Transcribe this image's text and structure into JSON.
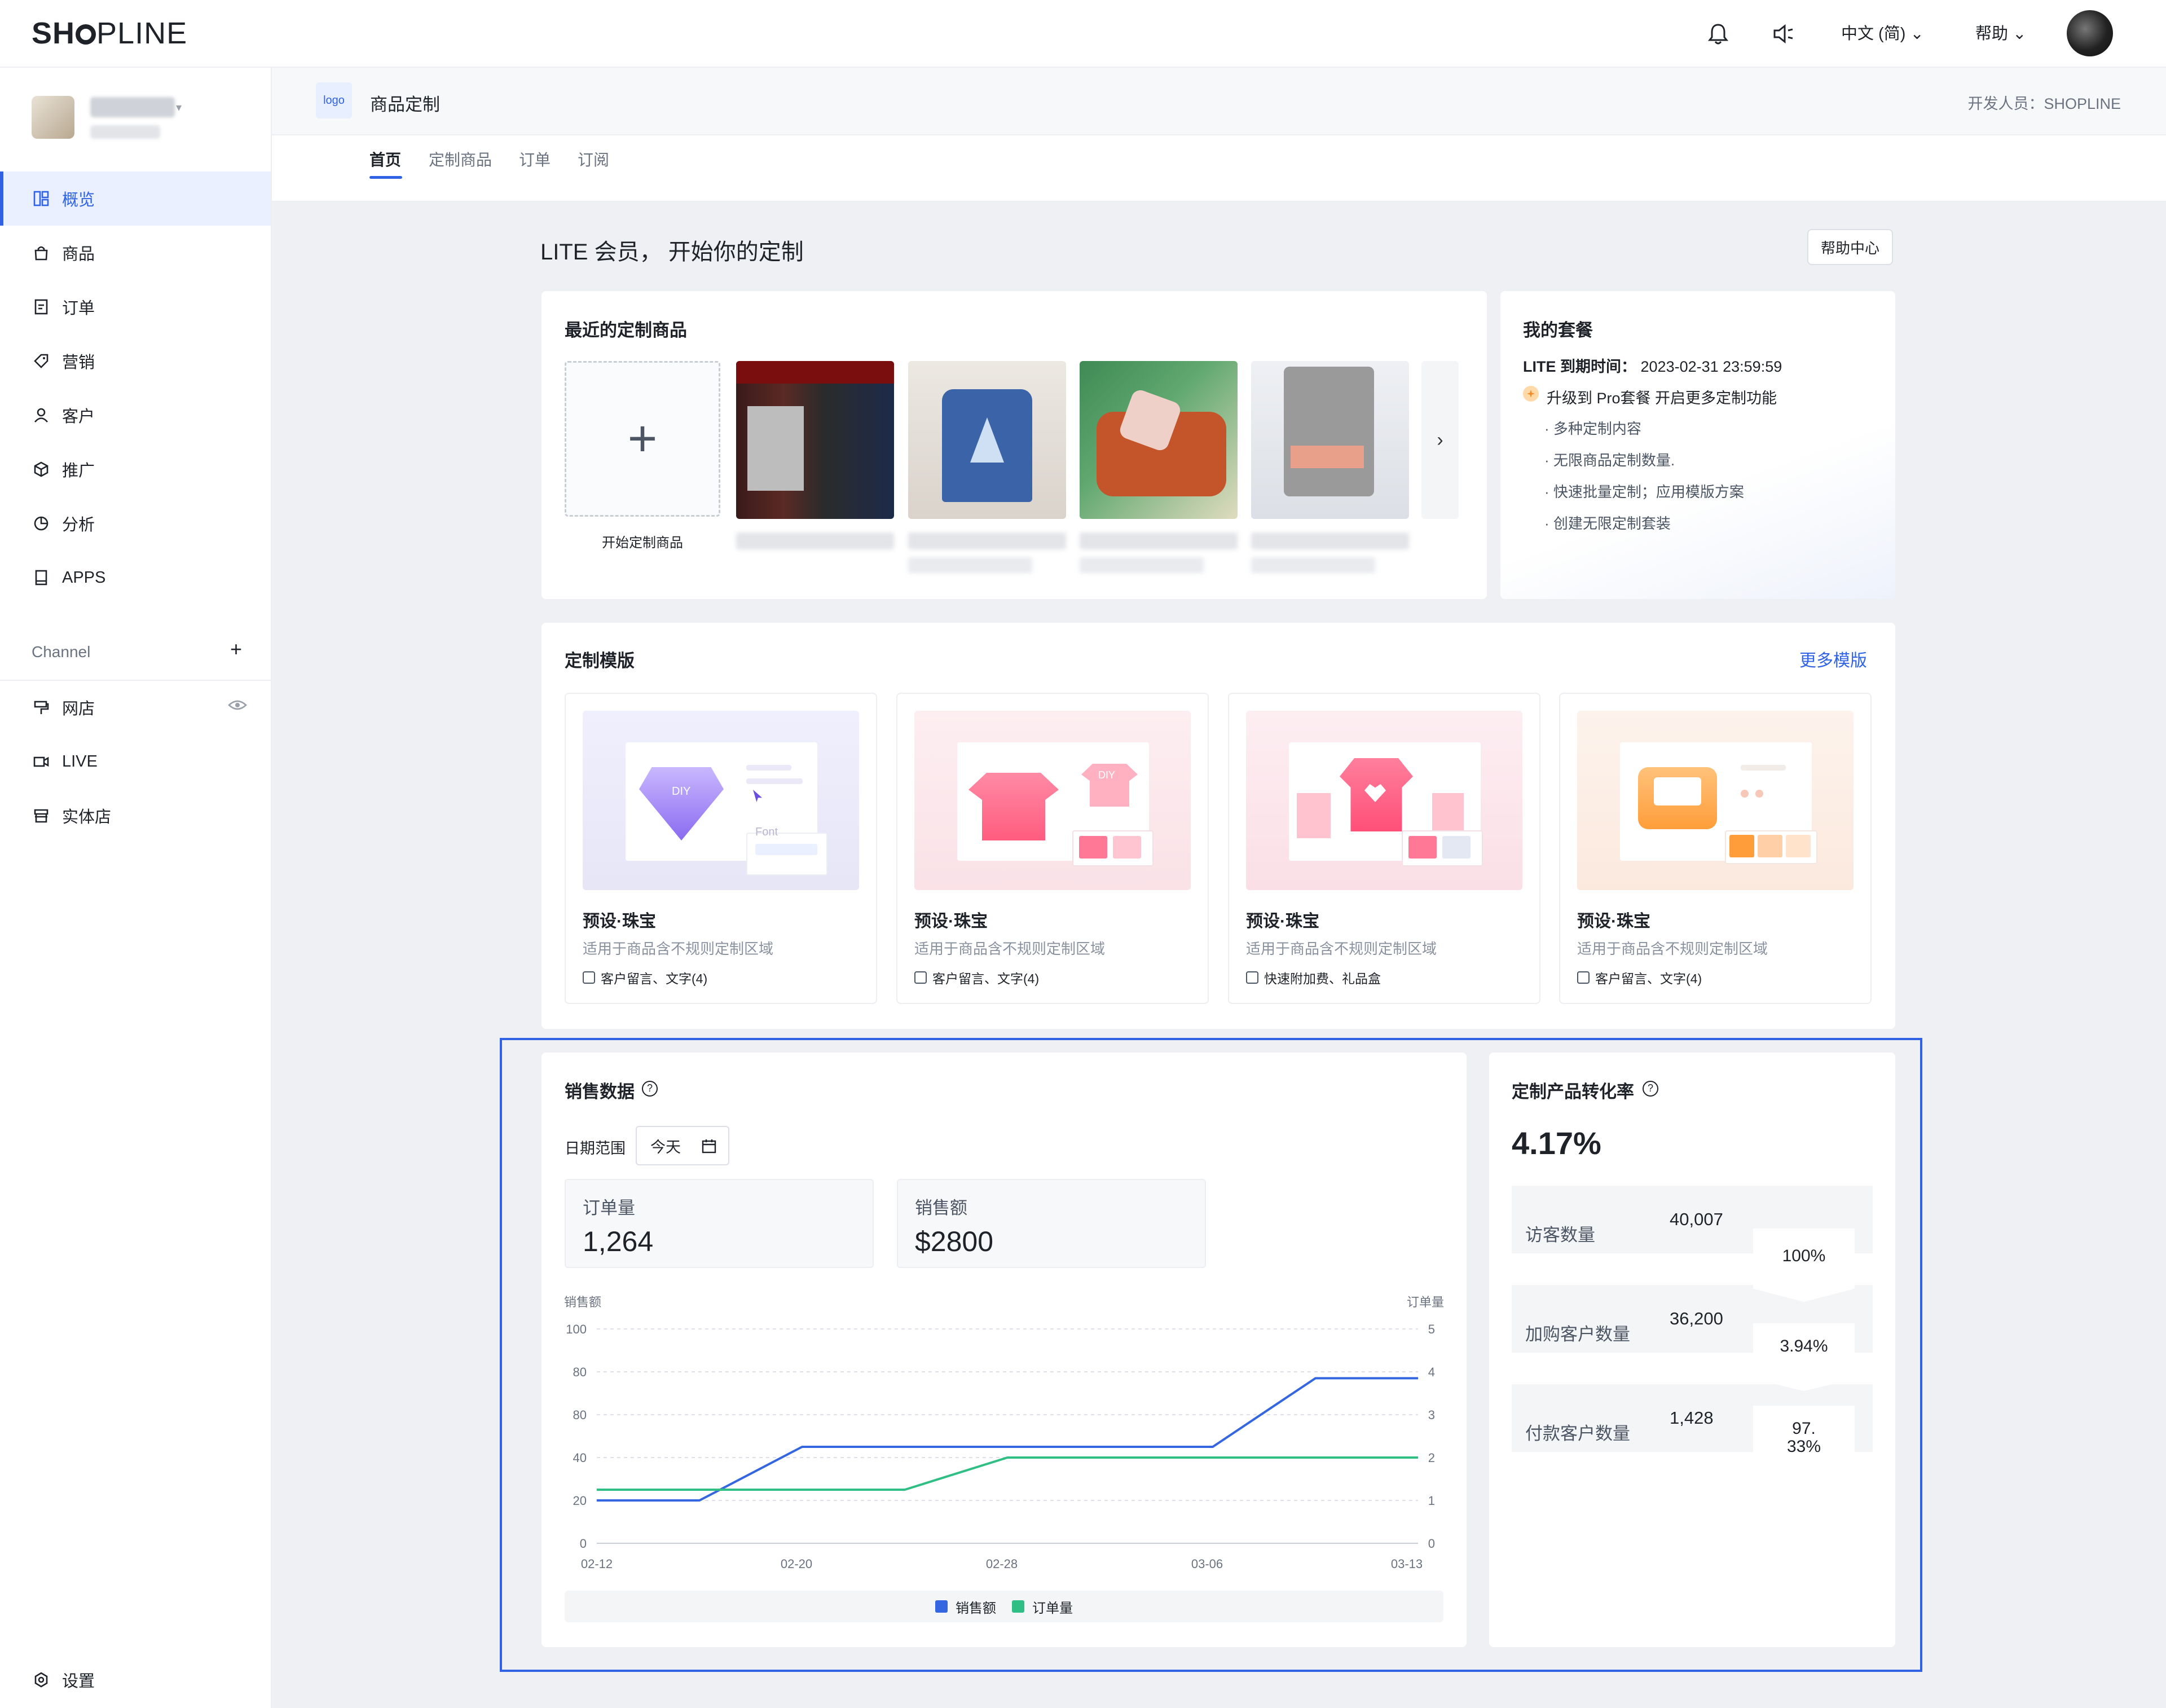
{
  "brand": {
    "logo_a": "SH",
    "logo_b": "PLINE"
  },
  "topbar": {
    "language": "中文 (简)",
    "help": "帮助"
  },
  "store": {
    "name": "",
    "sub": ""
  },
  "sidebar": {
    "items": [
      {
        "label": "概览",
        "icon": "overview-icon"
      },
      {
        "label": "商品",
        "icon": "bag-icon"
      },
      {
        "label": "订单",
        "icon": "order-icon"
      },
      {
        "label": "营销",
        "icon": "tag-icon"
      },
      {
        "label": "客户",
        "icon": "user-icon"
      },
      {
        "label": "推广",
        "icon": "cube-icon"
      },
      {
        "label": "分析",
        "icon": "pie-icon"
      },
      {
        "label": "APPS",
        "icon": "apps-icon"
      }
    ],
    "channel_title": "Channel",
    "channel_items": [
      {
        "label": "网店",
        "icon": "store-icon"
      },
      {
        "label": "LIVE",
        "icon": "video-icon"
      },
      {
        "label": "实体店",
        "icon": "shop-icon"
      }
    ],
    "settings": "设置"
  },
  "app": {
    "logo": "logo",
    "title": "商品定制",
    "developer": "开发人员：SHOPLINE"
  },
  "tabs": [
    "首页",
    "定制商品",
    "订单",
    "订阅"
  ],
  "main": {
    "greeting": "LITE 会员， 开始你的定制",
    "help_center": "帮助中心"
  },
  "recent": {
    "title": "最近的定制商品",
    "add_label": "开始定制商品",
    "next": "›"
  },
  "plan": {
    "title": "我的套餐",
    "expiry_label": "LITE 到期时间：",
    "expiry_value": "2023-02-31 23:59:59",
    "upgrade": "升级到 Pro套餐 开启更多定制功能",
    "features": [
      "· 多种定制内容",
      "· 无限商品定制数量.",
      "· 快速批量定制；应用模版方案",
      "· 创建无限定制套装"
    ]
  },
  "templates": {
    "title": "定制模版",
    "more": "更多模版",
    "items": [
      {
        "title": "预设·珠宝",
        "desc": "适用于商品含不规则定制区域",
        "tag": "客户留言、文字(4)",
        "art_text": "DIY",
        "art_font": "Font"
      },
      {
        "title": "预设·珠宝",
        "desc": "适用于商品含不规则定制区域",
        "tag": "客户留言、文字(4)",
        "art_text": "DIY"
      },
      {
        "title": "预设·珠宝",
        "desc": "适用于商品含不规则定制区域",
        "tag": "快速附加费、礼品盒"
      },
      {
        "title": "预设·珠宝",
        "desc": "适用于商品含不规则定制区域",
        "tag": "客户留言、文字(4)"
      }
    ]
  },
  "sales": {
    "title": "销售数据",
    "date_label": "日期范围",
    "date_value": "今天",
    "orders_label": "订单量",
    "orders_value": "1,264",
    "revenue_label": "销售额",
    "revenue_value": "$2800"
  },
  "chart_data": {
    "type": "line",
    "x": [
      "02-12",
      "02-16",
      "02-20",
      "02-24",
      "02-28",
      "03-02",
      "03-06",
      "03-10",
      "03-13"
    ],
    "x_tick_labels": [
      "02-12",
      "02-20",
      "02-28",
      "03-06",
      "03-13"
    ],
    "left_axis_label": "销售额",
    "right_axis_label": "订单量",
    "left_ticks": [
      "0",
      "20",
      "40",
      "80",
      "80",
      "100"
    ],
    "right_ticks": [
      "0",
      "1",
      "2",
      "3",
      "4",
      "5"
    ],
    "left_range": [
      0,
      100
    ],
    "right_range": [
      0,
      5
    ],
    "series": [
      {
        "name": "销售额",
        "axis": "left",
        "color": "#3366e0",
        "values": [
          20,
          20,
          45,
          45,
          45,
          45,
          45,
          77,
          77
        ]
      },
      {
        "name": "订单量",
        "axis": "right",
        "color": "#2fbf85",
        "values": [
          1.25,
          1.25,
          1.25,
          1.25,
          2,
          2,
          2,
          2,
          2
        ]
      }
    ],
    "grid": true,
    "legend_position": "bottom"
  },
  "conversion": {
    "title": "定制产品转化率",
    "rate": "4.17%",
    "rows": [
      {
        "label": "访客数量",
        "value": "40,007",
        "pct": "100%"
      },
      {
        "label": "加购客户数量",
        "value": "36,200",
        "pct": "3.94%"
      },
      {
        "label": "付款客户数量",
        "value": "1,428",
        "pct_a": "97.",
        "pct_b": "33%"
      }
    ]
  },
  "colors": {
    "accent": "#2f62e5",
    "series_blue": "#3366e0",
    "series_green": "#2fbf85"
  }
}
